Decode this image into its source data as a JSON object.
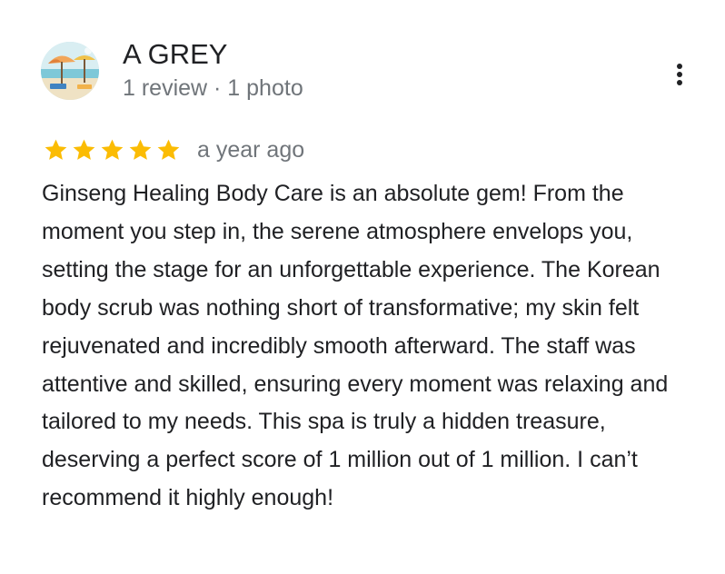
{
  "reviewer": {
    "name": "A GREY",
    "meta": "1 review · 1 photo",
    "avatar_icon": "beach-umbrella-photo"
  },
  "menu": {
    "icon": "more-vertical-icon"
  },
  "rating": {
    "stars": 5,
    "max": 5,
    "star_color": "#fbbc04",
    "date": "a year ago"
  },
  "review": {
    "text": "Ginseng Healing Body Care is an absolute gem! From the moment you step in, the serene atmosphere envelops you, setting the stage for an unforgettable experience. The Korean body scrub was nothing short of transformative; my skin felt rejuvenated and incredibly smooth afterward. The staff was attentive and skilled, ensuring every moment was relaxing and tailored to my needs. This spa is truly a hidden treasure, deserving a perfect score of 1 million out of 1 million. I can’t recommend it highly enough!"
  },
  "colors": {
    "primary_text": "#202124",
    "secondary_text": "#70757a",
    "star": "#fbbc04"
  }
}
